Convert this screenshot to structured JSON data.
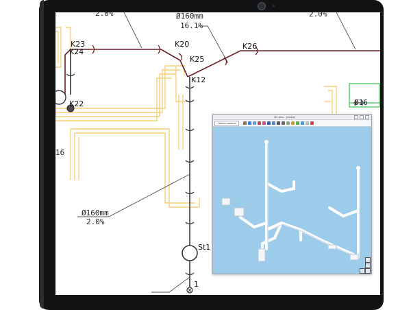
{
  "cad": {
    "pipe_labels": {
      "top_left_slope": "2.0%",
      "top_mid_diameter": "Ø160mm",
      "top_mid_slope": "16.1%",
      "top_right_slope": "2.0%",
      "bottom_diameter": "Ø160mm",
      "bottom_slope": "2.0%"
    },
    "nodes": {
      "k23": "K23",
      "k24": "K24",
      "k20": "K20",
      "k25": "K25",
      "k26": "K26",
      "k22": "K22",
      "k12": "K12",
      "st1": "St1",
      "p1": "1",
      "side_num": "16",
      "right_frag": "Ø16"
    }
  },
  "viewer": {
    "title": "3D view - [Active]",
    "camera_select": "- Select camera -"
  },
  "colors": {
    "pipe": "#6b1f24",
    "pipe_vertical": "#2f3a36",
    "walls": "#f6cf7a",
    "green_room": "#39c24a",
    "viewer_bg": "#9dccea"
  }
}
